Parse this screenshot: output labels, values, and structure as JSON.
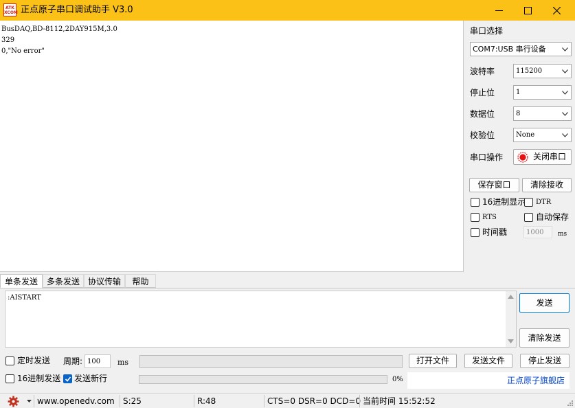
{
  "window": {
    "title": "正点原子串口调试助手 V3.0",
    "logo_top": "ATK",
    "logo_bottom": "XCOM"
  },
  "receive": {
    "lines": [
      "BusDAQ,BD-8112,2DAY915M,3.0",
      "329",
      "0,\"No error\""
    ]
  },
  "serial": {
    "port_select_label": "串口选择",
    "port_value": "COM7:USB 串行设备",
    "baud_label": "波特率",
    "baud_value": "115200",
    "stop_label": "停止位",
    "stop_value": "1",
    "data_label": "数据位",
    "data_value": "8",
    "parity_label": "校验位",
    "parity_value": "None",
    "operation_label": "串口操作",
    "close_port_label": "关闭串口",
    "indicator_color": "#e81010"
  },
  "actions": {
    "save_window": "保存窗口",
    "clear_receive": "清除接收"
  },
  "options": {
    "hex_display": "16进制显示",
    "dtr": "DTR",
    "rts": "RTS",
    "auto_save": "自动保存",
    "timestamp": "时间戳",
    "timestamp_value": "1000",
    "timestamp_unit": "ms"
  },
  "tabs": [
    "单条发送",
    "多条发送",
    "协议传输",
    "帮助"
  ],
  "send": {
    "text": ":AISTART",
    "send_button": "发送",
    "clear_send_button": "清除发送"
  },
  "bottom": {
    "timed_send": "定时发送",
    "period_label": "周期:",
    "period_value": "100",
    "period_unit": "ms",
    "open_file": "打开文件",
    "send_file": "发送文件",
    "stop_send": "停止发送",
    "hex_send": "16进制发送",
    "send_newline": "发送新行",
    "send_newline_checked": true,
    "progress_text": "0%",
    "progress": 0,
    "store_link": "正点原子旗舰店"
  },
  "status": {
    "website": "www.openedv.com",
    "sent": "S:25",
    "received": "R:48",
    "signals": "CTS=0 DSR=0 DCD=0",
    "time": "当前时间 15:52:52"
  },
  "colors": {
    "titlebar": "#fbc116",
    "checkbox_checked": "#0a64c8",
    "link": "#0044cc",
    "gear": "#c0311e"
  },
  "icons": {
    "minimize": "minimize-icon",
    "maximize": "maximize-icon",
    "close": "close-icon",
    "settings": "gear-icon",
    "dropdown": "chevron-down-icon",
    "status_light": "indicator-icon"
  }
}
